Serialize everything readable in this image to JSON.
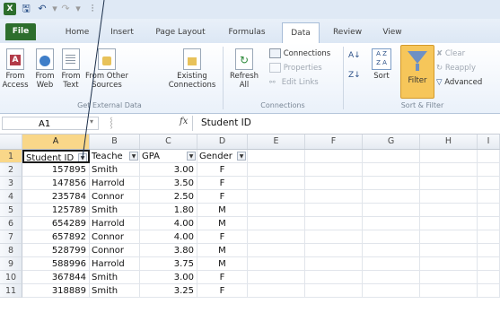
{
  "qat": {
    "icons": [
      "excel-icon",
      "save-icon",
      "undo-icon",
      "redo-icon",
      "customize-icon"
    ]
  },
  "tabs": [
    {
      "label": "File"
    },
    {
      "label": "Home"
    },
    {
      "label": "Insert"
    },
    {
      "label": "Page Layout"
    },
    {
      "label": "Formulas"
    },
    {
      "label": "Data"
    },
    {
      "label": "Review"
    },
    {
      "label": "View"
    }
  ],
  "ribbon": {
    "get_external_data": {
      "label": "Get External Data",
      "from_access": [
        "From",
        "Access"
      ],
      "from_web": [
        "From",
        "Web"
      ],
      "from_text": [
        "From",
        "Text"
      ],
      "from_other": [
        "From Other",
        "Sources"
      ],
      "existing": [
        "Existing",
        "Connections"
      ]
    },
    "connections": {
      "label": "Connections",
      "refresh": [
        "Refresh",
        "All"
      ],
      "connections": "Connections",
      "properties": "Properties",
      "edit_links": "Edit Links"
    },
    "sort_filter": {
      "label": "Sort & Filter",
      "sort": "Sort",
      "filter": "Filter",
      "clear": "Clear",
      "reapply": "Reapply",
      "advanced": "Advanced"
    }
  },
  "formula_bar": {
    "name_box": "A1",
    "fx": "fx",
    "content": "Student ID"
  },
  "columns": [
    "A",
    "B",
    "C",
    "D",
    "E",
    "F",
    "G",
    "H",
    "I"
  ],
  "header_row": {
    "a": "Student ID",
    "b": "Teache",
    "c": "GPA",
    "d": "Gender"
  },
  "rows": [
    {
      "num": "1"
    },
    {
      "num": "2",
      "id": "157895",
      "teacher": "Smith",
      "gpa": "3.00",
      "gender": "F"
    },
    {
      "num": "3",
      "id": "147856",
      "teacher": "Harrold",
      "gpa": "3.50",
      "gender": "F"
    },
    {
      "num": "4",
      "id": "235784",
      "teacher": "Connor",
      "gpa": "2.50",
      "gender": "F"
    },
    {
      "num": "5",
      "id": "125789",
      "teacher": "Smith",
      "gpa": "1.80",
      "gender": "M"
    },
    {
      "num": "6",
      "id": "654289",
      "teacher": "Harrold",
      "gpa": "4.00",
      "gender": "M"
    },
    {
      "num": "7",
      "id": "657892",
      "teacher": "Connor",
      "gpa": "4.00",
      "gender": "F"
    },
    {
      "num": "8",
      "id": "528799",
      "teacher": "Connor",
      "gpa": "3.80",
      "gender": "M"
    },
    {
      "num": "9",
      "id": "588996",
      "teacher": "Harrold",
      "gpa": "3.75",
      "gender": "M"
    },
    {
      "num": "10",
      "id": "367844",
      "teacher": "Smith",
      "gpa": "3.00",
      "gender": "F"
    },
    {
      "num": "11",
      "id": "318889",
      "teacher": "Smith",
      "gpa": "3.25",
      "gender": "F"
    }
  ],
  "colors": {
    "accent": "#f9d789",
    "file_tab": "#2d6e2d",
    "filter_active": "#f6c65a"
  }
}
